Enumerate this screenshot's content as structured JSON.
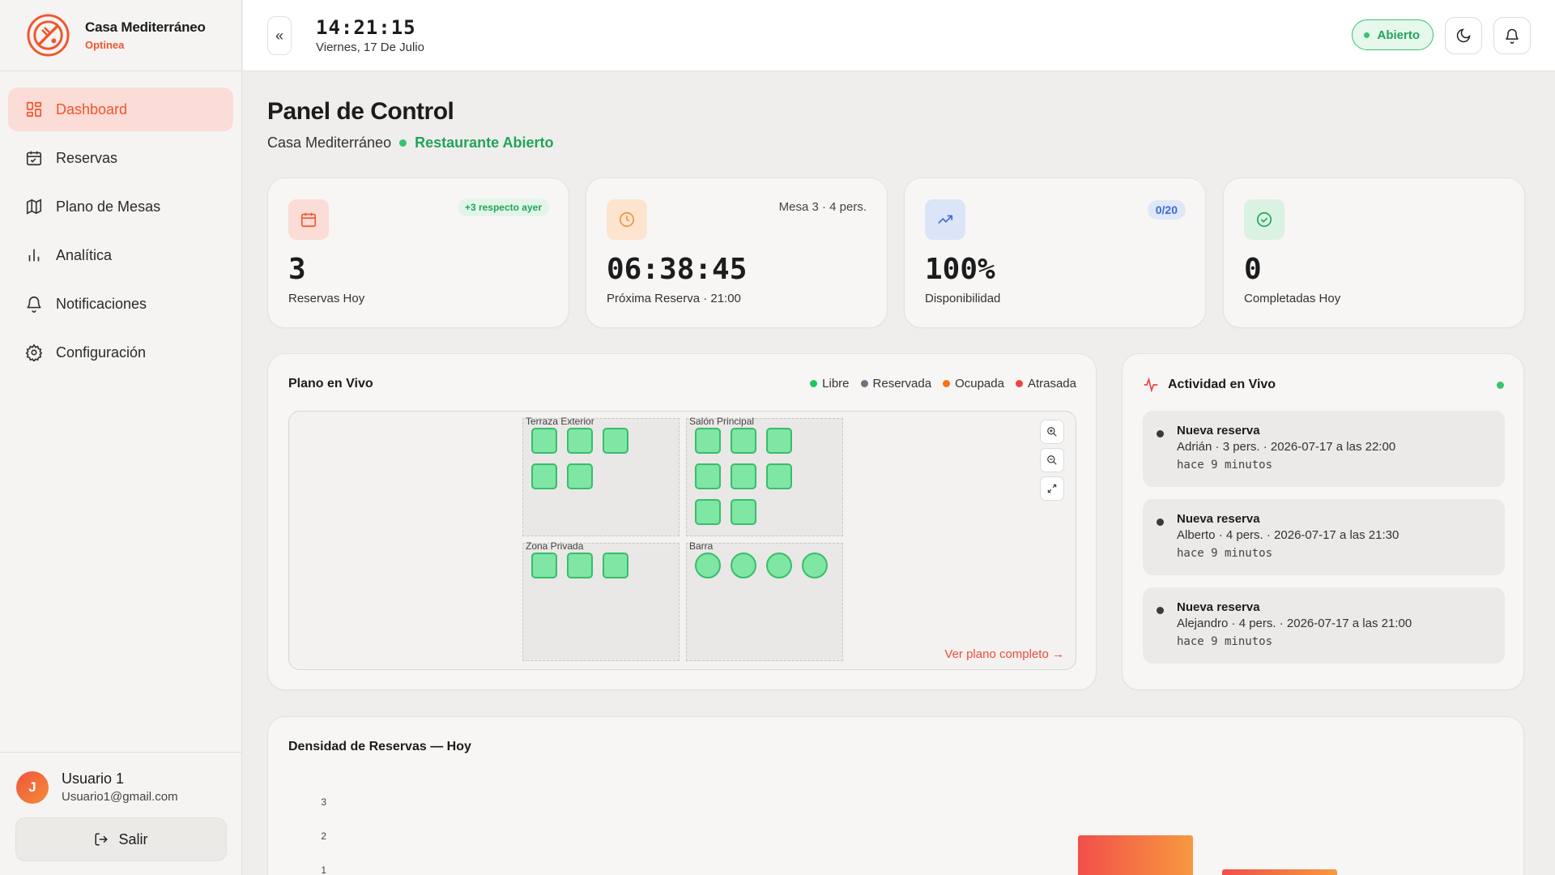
{
  "brand": {
    "name": "Casa Mediterráneo",
    "subtitle": "Optinea"
  },
  "nav": [
    {
      "label": "Dashboard",
      "icon": "dashboard-icon",
      "active": true
    },
    {
      "label": "Reservas",
      "icon": "calendar-icon"
    },
    {
      "label": "Plano de Mesas",
      "icon": "map-icon"
    },
    {
      "label": "Analítica",
      "icon": "bar-chart-icon"
    },
    {
      "label": "Notificaciones",
      "icon": "bell-icon"
    },
    {
      "label": "Configuración",
      "icon": "gear-icon"
    }
  ],
  "user": {
    "initial": "J",
    "name": "Usuario 1",
    "email": "Usuario1@gmail.com",
    "logout_label": "Salir"
  },
  "header": {
    "collapse_label": "«",
    "time": "14:21:15",
    "date": "Viernes, 17 De Julio",
    "status": "Abierto"
  },
  "page": {
    "title": "Panel de Control",
    "restaurant": "Casa Mediterráneo",
    "status": "Restaurante Abierto"
  },
  "stats": [
    {
      "value": "3",
      "label": "Reservas Hoy",
      "badge": "+3 respecto ayer",
      "icon": "calendar-icon",
      "color": "#f0552e"
    },
    {
      "value": "06:38:45",
      "label": "Próxima Reserva · 21:00",
      "note": "Mesa 3 · 4 pers.",
      "icon": "clock-icon",
      "color": "#f3913a"
    },
    {
      "value": "100%",
      "label": "Disponibilidad",
      "chip": "0/20",
      "icon": "trending-up-icon",
      "color": "#3c6ad8"
    },
    {
      "value": "0",
      "label": "Completadas Hoy",
      "icon": "check-circle-icon",
      "color": "#22a45a"
    }
  ],
  "plano": {
    "title": "Plano en Vivo",
    "legend": [
      {
        "label": "Libre",
        "color": "#22c55e"
      },
      {
        "label": "Reservada",
        "color": "#6b7280"
      },
      {
        "label": "Ocupada",
        "color": "#f97316"
      },
      {
        "label": "Atrasada",
        "color": "#ef4444"
      }
    ],
    "zones": [
      {
        "name": "Terraza Exterior"
      },
      {
        "name": "Salón Principal"
      },
      {
        "name": "Zona Privada"
      },
      {
        "name": "Barra"
      }
    ],
    "link": "Ver plano completo →"
  },
  "actividad": {
    "title": "Actividad en Vivo",
    "items": [
      {
        "title": "Nueva reserva",
        "desc": "Adrián · 3 pers. · 2026-07-17 a las 22:00",
        "time": "hace 9 minutos"
      },
      {
        "title": "Nueva reserva",
        "desc": "Alberto · 4 pers. · 2026-07-17 a las 21:30",
        "time": "hace 9 minutos"
      },
      {
        "title": "Nueva reserva",
        "desc": "Alejandro · 4 pers. · 2026-07-17 a las 21:00",
        "time": "hace 9 minutos"
      }
    ]
  },
  "densidad": {
    "title": "Densidad de Reservas — Hoy"
  },
  "chart_data": {
    "type": "bar",
    "title": "Densidad de Reservas — Hoy",
    "yticks": [
      "3",
      "2",
      "1"
    ],
    "ylim": [
      0,
      3
    ],
    "values": [
      2,
      1
    ],
    "colors": [
      "#f14f4a",
      "#f7993f"
    ]
  }
}
